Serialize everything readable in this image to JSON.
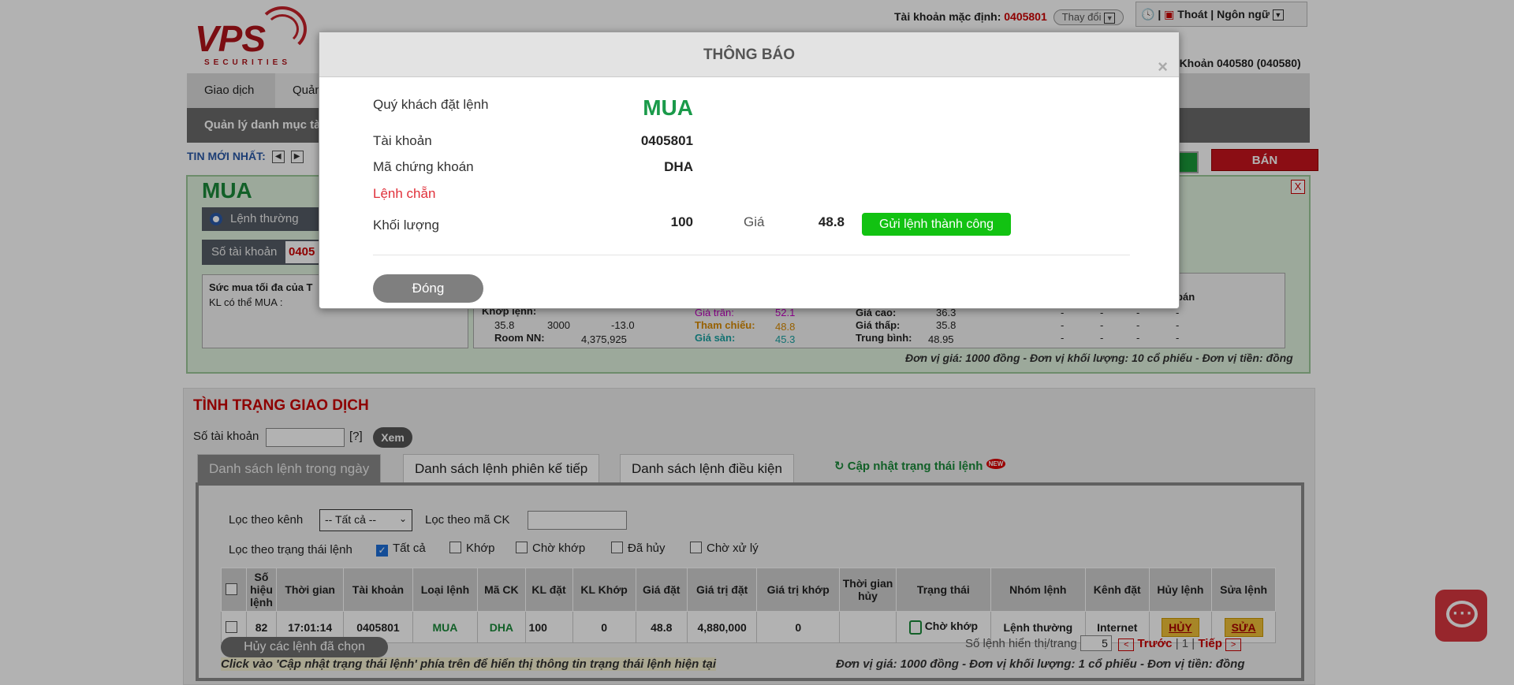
{
  "header": {
    "logo_text": "VPS",
    "logo_subtext": "SECURITIES",
    "default_account_label": "Tài khoản mặc định:",
    "default_account_value": "0405801",
    "change_button": "Thay đổi",
    "logout": "Thoát",
    "language": "Ngôn ngữ",
    "account_right": "ài Khoản 040580 (040580)"
  },
  "nav": {
    "tabs": [
      "Giao dịch",
      "Quản"
    ],
    "subnav": "Quản lý danh mục tà"
  },
  "news": {
    "label": "TIN MỚI NHẤT:"
  },
  "order_form": {
    "title": "MUA",
    "sell_button": "BÁN",
    "close": "X",
    "order_type": "Lệnh thường",
    "account_label": "Số tài khoản",
    "account_value": "0405",
    "buying_power_title": "Sức mua tối đa của T",
    "max_buy_label": "KL có thể MUA :",
    "sell_side_label": "ư bán",
    "quote": {
      "match_label": "Khớp lệnh:",
      "match_price": "35.8",
      "match_volume": "3000",
      "match_change": "-13.0",
      "room_label": "Room NN:",
      "room_value": "4,375,925",
      "ceiling_label": "Giá trần:",
      "ceiling_value": "52.1",
      "ref_label": "Tham chiếu:",
      "ref_value": "48.8",
      "floor_label": "Giá sàn:",
      "floor_value": "45.3",
      "high_label": "Giá cao:",
      "high_value": "36.3",
      "low_label": "Giá thấp:",
      "low_value": "35.8",
      "avg_label": "Trung bình:",
      "avg_value": "48.95",
      "dash": "-"
    },
    "unit_note": "Đơn vị giá: 1000 đồng - Đơn vị khối lượng: 10 cổ phiếu - Đơn vị tiền: đồng"
  },
  "status": {
    "title": "TÌNH TRẠNG GIAO DỊCH",
    "account_label": "Số tài khoản",
    "help": "[?]",
    "view_button": "Xem",
    "tabs": [
      "Danh sách lệnh trong ngày",
      "Danh sách lệnh phiên kế tiếp",
      "Danh sách lệnh điều kiện"
    ],
    "refresh": "Cập nhật trạng thái lệnh",
    "new_badge": "NEW",
    "filter_channel_label": "Lọc theo kênh",
    "filter_channel_value": "-- Tất cả --",
    "filter_code_label": "Lọc theo mã CK",
    "filter_status_label": "Lọc theo trạng thái lệnh",
    "status_options": [
      "Tất cả",
      "Khớp",
      "Chờ khớp",
      "Đã hủy",
      "Chờ xử lý"
    ],
    "columns": [
      "Số hiệu lệnh",
      "Thời gian",
      "Tài khoản",
      "Loại lệnh",
      "Mã CK",
      "KL đặt",
      "KL Khớp",
      "Giá đặt",
      "Giá trị đặt",
      "Giá trị khớp",
      "Thời gian hủy",
      "Trạng thái",
      "Nhóm lệnh",
      "Kênh đặt",
      "Hủy lệnh",
      "Sửa lệnh"
    ],
    "rows": [
      {
        "id": "82",
        "time": "17:01:14",
        "account": "0405801",
        "type": "MUA",
        "code": "DHA",
        "qty": "100",
        "matched_qty": "0",
        "price": "48.8",
        "value": "4,880,000",
        "matched_value": "0",
        "cancel_time": "",
        "status": "Chờ khớp",
        "group": "Lệnh thường",
        "channel": "Internet",
        "cancel_btn": "HỦY",
        "edit_btn": "SỬA"
      }
    ],
    "cancel_selected": "Hủy các lệnh đã chọn",
    "per_page_label": "Số lệnh hiển thị/trang",
    "per_page_value": "5",
    "prev": "Trước",
    "page_info": "| 1 |",
    "next": "Tiếp",
    "hint": "Click vào 'Cập nhật trạng thái lệnh' phía trên để hiển thị thông tin trạng thái lệnh hiện tại",
    "unit_note": "Đơn vị giá: 1000 đồng - Đơn vị khối lượng: 1 cổ phiếu - Đơn vị tiền: đồng"
  },
  "modal": {
    "title": "THÔNG BÁO",
    "close_x": "×",
    "order_label": "Quý khách đặt lệnh",
    "order_side": "MUA",
    "account_label": "Tài khoản",
    "account_value": "0405801",
    "code_label": "Mã chứng khoán",
    "code_value": "DHA",
    "lot_label": "Lệnh chẵn",
    "qty_label": "Khối lượng",
    "qty_value": "100",
    "price_label": "Giá",
    "price_value": "48.8",
    "success": "Gửi lệnh thành công",
    "close_button": "Đóng"
  },
  "colors": {
    "buy_green": "#1a9a4a",
    "sell_red": "#c8141e",
    "success_green": "#12c212",
    "brand_red": "#b0141b"
  }
}
